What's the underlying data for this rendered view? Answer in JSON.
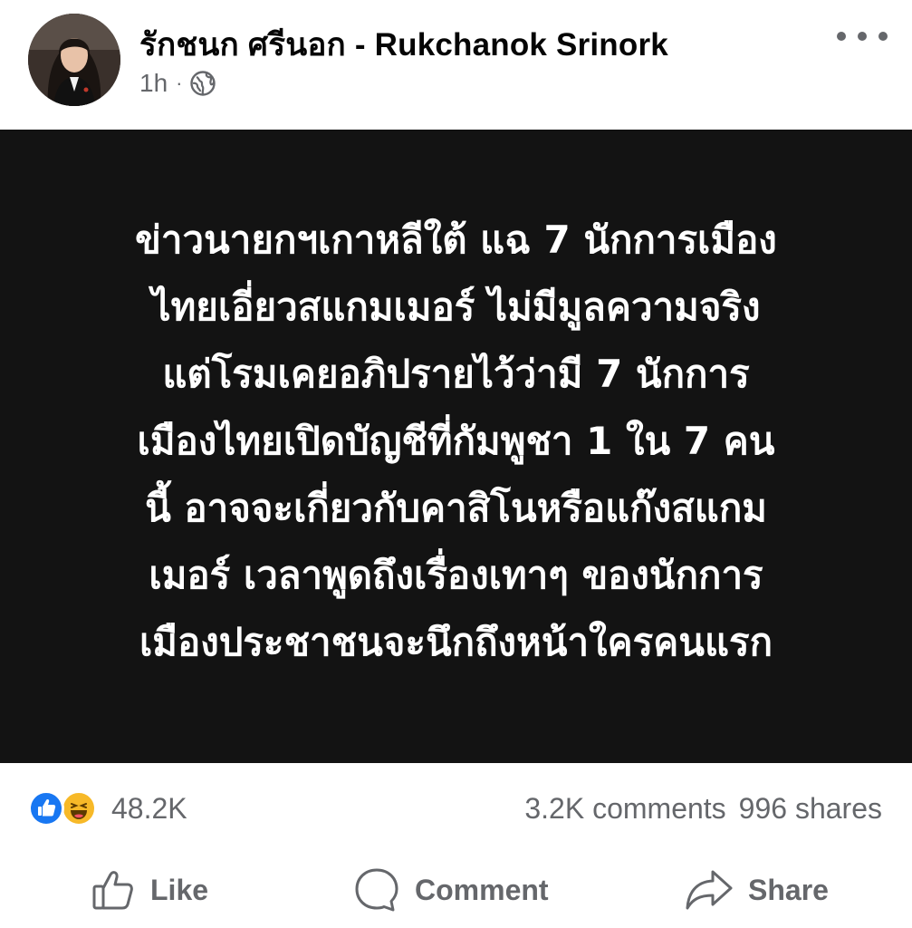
{
  "post": {
    "author": "รักชนก ศรีนอก - Rukchanok Srinork",
    "time": "1h",
    "separator": "·",
    "audience_icon": "globe-icon",
    "more_icon": "more-horizontal-icon",
    "card_background": "#131313",
    "card_text": "ข่าวนายกฯเกาหลีใต้ แฉ 7 นักการเมือง\nไทยเอี่ยวสแกมเมอร์ ไม่มีมูลความจริง\nแต่โรมเคยอภิปรายไว้ว่ามี 7 นักการ\nเมืองไทยเปิดบัญชีที่กัมพูชา 1 ใน 7 คน\nนี้ อาจจะเกี่ยวกับคาสิโนหรือแก๊งสแกม\nเมอร์ เวลาพูดถึงเรื่องเทาๆ ของนักการ\nเมืองประชาชนจะนึกถึงหน้าใครคนแรก"
  },
  "stats": {
    "reaction_icons": [
      "like-reaction-icon",
      "haha-reaction-icon"
    ],
    "reaction_count": "48.2K",
    "comments": "3.2K comments",
    "shares": "996 shares"
  },
  "actions": {
    "like": "Like",
    "comment": "Comment",
    "share": "Share"
  },
  "colors": {
    "like_blue": "#1877f2",
    "haha_yellow": "#f7b928",
    "secondary_text": "#65676b"
  }
}
